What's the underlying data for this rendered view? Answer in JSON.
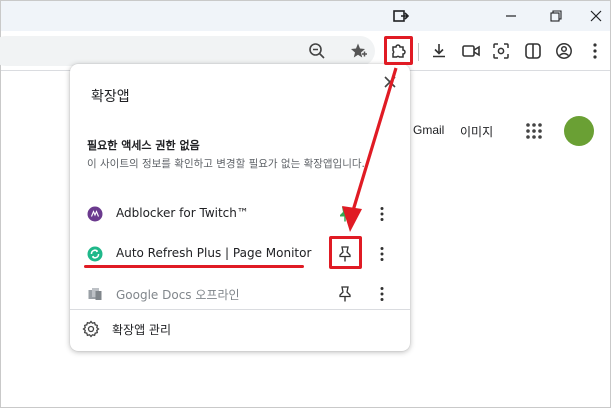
{
  "popup": {
    "title": "확장앱",
    "section_title": "필요한 액세스 권한 없음",
    "section_desc": "이 사이트의 정보를 확인하고 변경할 필요가 없는 확장앱입니다.",
    "extensions": [
      {
        "name": "Adblocker for Twitch™",
        "icon": "adblocker-twitch-icon",
        "pinned": true
      },
      {
        "name": "Auto Refresh Plus | Page Monitor",
        "icon": "auto-refresh-icon",
        "pinned": false
      },
      {
        "name": "Google Docs 오프라인",
        "icon": "google-docs-offline-icon",
        "pinned": false
      }
    ],
    "manage_label": "확장앱 관리"
  },
  "page": {
    "gmail_link": "Gmail",
    "images_link": "이미지"
  },
  "colors": {
    "annotation": "#e01b24",
    "avatar": "#6aa034",
    "pin_active": "#34a853"
  }
}
